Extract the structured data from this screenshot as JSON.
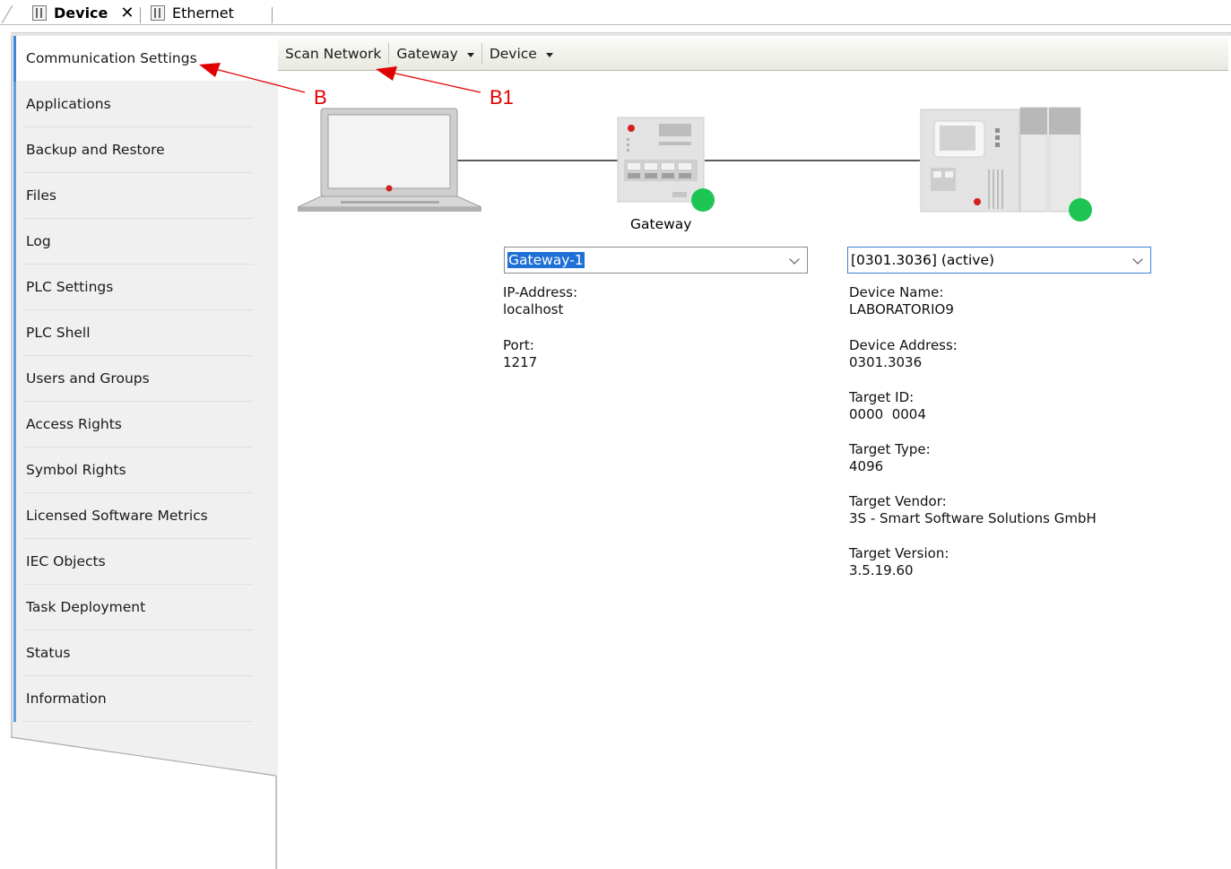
{
  "tabs": [
    {
      "label": "Device",
      "active": true,
      "icon": "device-icon"
    },
    {
      "label": "Ethernet",
      "active": false,
      "icon": "device-icon"
    }
  ],
  "sidebar": {
    "items": [
      {
        "label": "Communication Settings",
        "active": true
      },
      {
        "label": "Applications"
      },
      {
        "label": "Backup and Restore"
      },
      {
        "label": "Files"
      },
      {
        "label": "Log"
      },
      {
        "label": "PLC Settings"
      },
      {
        "label": "PLC Shell"
      },
      {
        "label": "Users and Groups"
      },
      {
        "label": "Access Rights"
      },
      {
        "label": "Symbol Rights"
      },
      {
        "label": "Licensed Software Metrics"
      },
      {
        "label": "IEC Objects"
      },
      {
        "label": "Task Deployment"
      },
      {
        "label": "Status"
      },
      {
        "label": "Information"
      }
    ]
  },
  "toolbar": {
    "scan_label": "Scan Network",
    "gateway_label": "Gateway",
    "device_label": "Device"
  },
  "diagram": {
    "gateway_caption": "Gateway",
    "status_color": "#1fc552"
  },
  "gateway_panel": {
    "selected": "Gateway-1",
    "ip_label": "IP-Address:",
    "ip_value": "localhost",
    "port_label": "Port:",
    "port_value": "1217"
  },
  "device_panel": {
    "selected": "[0301.3036] (active)",
    "name_label": "Device Name:",
    "name_value": "LABORATORIO9",
    "address_label": "Device Address:",
    "address_value": "0301.3036",
    "target_id_label": "Target ID:",
    "target_id_value": "0000  0004",
    "target_type_label": "Target Type:",
    "target_type_value": "4096",
    "vendor_label": "Target Vendor:",
    "vendor_value": "3S - Smart Software Solutions GmbH",
    "version_label": "Target Version:",
    "version_value": "3.5.19.60"
  },
  "annotations": {
    "b": "B",
    "b1": "B1",
    "color": "#e00000"
  }
}
